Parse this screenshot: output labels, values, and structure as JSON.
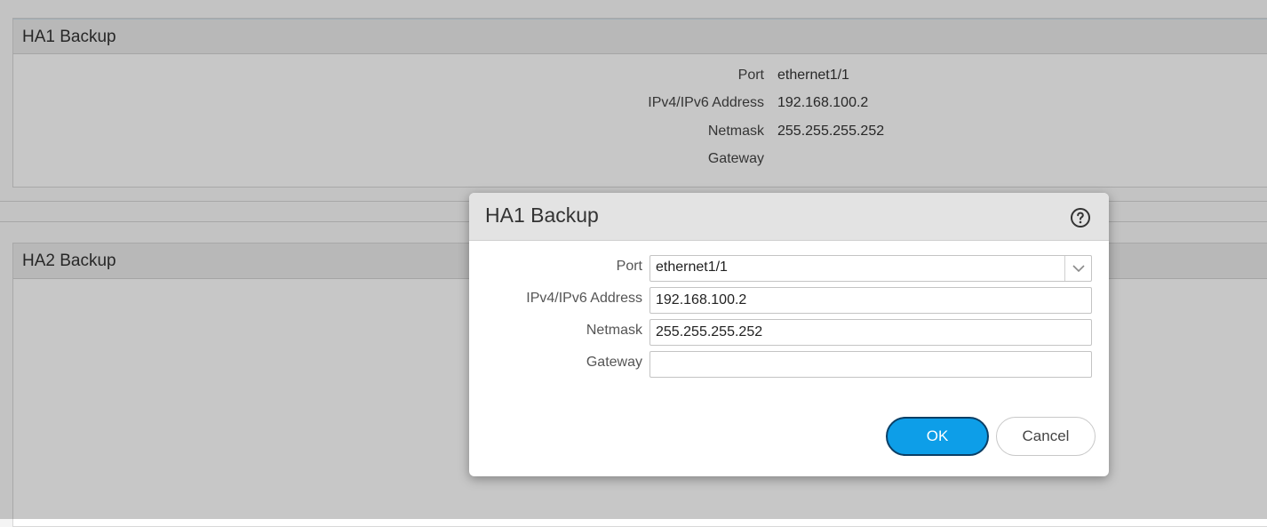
{
  "background": {
    "ha1_panel": {
      "title": "HA1 Backup",
      "rows": [
        {
          "label": "Port",
          "value": "ethernet1/1"
        },
        {
          "label": "IPv4/IPv6 Address",
          "value": "192.168.100.2"
        },
        {
          "label": "Netmask",
          "value": "255.255.255.252"
        },
        {
          "label": "Gateway",
          "value": ""
        }
      ]
    },
    "ha2_panel": {
      "title": "HA2 Backup"
    }
  },
  "dialog": {
    "title": "HA1 Backup",
    "help_icon": "help-circle-icon",
    "fields": {
      "port": {
        "label": "Port",
        "value": "ethernet1/1",
        "icon": "chevron-down-icon"
      },
      "address": {
        "label": "IPv4/IPv6 Address",
        "value": "192.168.100.2"
      },
      "netmask": {
        "label": "Netmask",
        "value": "255.255.255.252"
      },
      "gateway": {
        "label": "Gateway",
        "value": ""
      }
    },
    "buttons": {
      "ok": "OK",
      "cancel": "Cancel"
    }
  },
  "colors": {
    "accent": "#0d9ee8",
    "accent_border": "#0b3f66",
    "header_bg": "#e3e3e3"
  }
}
